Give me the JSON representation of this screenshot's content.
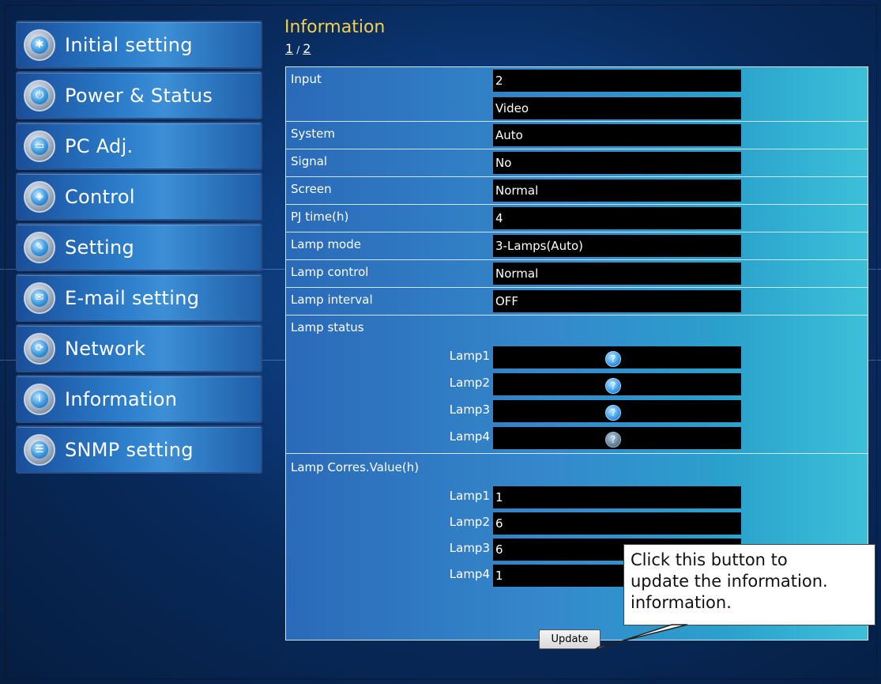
{
  "sidebar": {
    "items": [
      {
        "label": "Initial setting",
        "icon": "gear-icon",
        "glyph": "✱"
      },
      {
        "label": "Power & Status",
        "icon": "power-icon",
        "glyph": "⏻"
      },
      {
        "label": "PC Adj.",
        "icon": "monitor-icon",
        "glyph": "▭"
      },
      {
        "label": "Control",
        "icon": "control-icon",
        "glyph": "◈"
      },
      {
        "label": "Setting",
        "icon": "wrench-icon",
        "glyph": "✎"
      },
      {
        "label": "E-mail setting",
        "icon": "envelope-icon",
        "glyph": "✉"
      },
      {
        "label": "Network",
        "icon": "network-icon",
        "glyph": "⟳"
      },
      {
        "label": "Information",
        "icon": "info-icon",
        "glyph": "i"
      },
      {
        "label": "SNMP setting",
        "icon": "snmp-icon",
        "glyph": "☰"
      }
    ]
  },
  "header": {
    "title": "Information",
    "pager": {
      "current": "1",
      "separator": "/",
      "next": "2"
    }
  },
  "info": {
    "input_label": "Input",
    "input_values": [
      "2",
      "Video"
    ],
    "rows": [
      {
        "label": "System",
        "value": "Auto"
      },
      {
        "label": "Signal",
        "value": "No"
      },
      {
        "label": "Screen",
        "value": "Normal"
      },
      {
        "label": "PJ time(h)",
        "value": "4"
      },
      {
        "label": "Lamp mode",
        "value": "3-Lamps(Auto)"
      },
      {
        "label": "Lamp control",
        "value": "Normal"
      },
      {
        "label": "Lamp interval",
        "value": "OFF"
      }
    ],
    "lamp_status": {
      "label": "Lamp status",
      "lamps": [
        {
          "name": "Lamp1",
          "state": "on"
        },
        {
          "name": "Lamp2",
          "state": "on"
        },
        {
          "name": "Lamp3",
          "state": "on"
        },
        {
          "name": "Lamp4",
          "state": "off"
        }
      ]
    },
    "lamp_corres": {
      "label": "Lamp Corres.Value(h)",
      "lamps": [
        {
          "name": "Lamp1",
          "value": "1"
        },
        {
          "name": "Lamp2",
          "value": "6"
        },
        {
          "name": "Lamp3",
          "value": "6"
        },
        {
          "name": "Lamp4",
          "value": "1"
        }
      ]
    }
  },
  "update_button": {
    "label": "Update"
  },
  "callout": {
    "lines": [
      "Click this button to",
      "update the information.",
      "information."
    ]
  },
  "colors": {
    "title": "#f5d14a",
    "value_bg": "#000000",
    "panel_border": "#cde6f8"
  }
}
